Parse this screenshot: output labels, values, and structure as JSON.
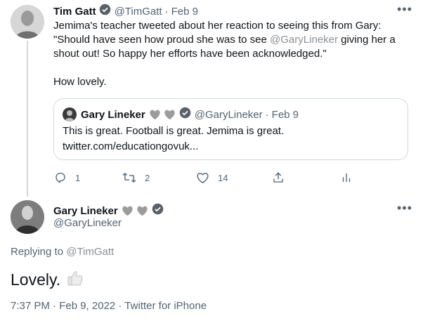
{
  "tweet1": {
    "name": "Tim Gatt",
    "handle": "@TimGatt",
    "sep": "·",
    "date": "Feb 9",
    "body_line1": "Jemima's teacher tweeted about her reaction to seeing this from Gary:",
    "body_line2_pre": "\"Should have seen how proud she was to see ",
    "body_line2_mention": "@GaryLineker",
    "body_line2_post": " giving her a",
    "body_line3": "shout out! So happy her efforts have been acknowledged.\"",
    "body_line4": "How lovely.",
    "quote": {
      "name": "Gary Lineker",
      "handle": "@GaryLineker",
      "sep": "·",
      "date": "Feb 9",
      "text": "This is great. Football is great. Jemima is great.",
      "link": "twitter.com/educationgovuk..."
    },
    "actions": {
      "reply_count": "1",
      "retweet_count": "2",
      "like_count": "14"
    }
  },
  "tweet2": {
    "name": "Gary Lineker",
    "handle": "@GaryLineker",
    "replying_prefix": "Replying to ",
    "replying_handle": "@TimGatt",
    "text": "Lovely.",
    "timestamp": "7:37 PM · Feb 9, 2022 · Twitter for iPhone"
  },
  "icons": {
    "more": "more-icon",
    "verified": "verified-badge-icon",
    "heart_emoji": "grey-heart-emoji",
    "thumbs_up": "thumbs-up-emoji",
    "reply": "reply-icon",
    "retweet": "retweet-icon",
    "like": "like-icon",
    "share": "share-icon",
    "analytics": "analytics-icon"
  },
  "colors": {
    "text": "#0f1419",
    "muted": "#536471",
    "mention": "#8a8f94",
    "border": "#cfd9de"
  }
}
